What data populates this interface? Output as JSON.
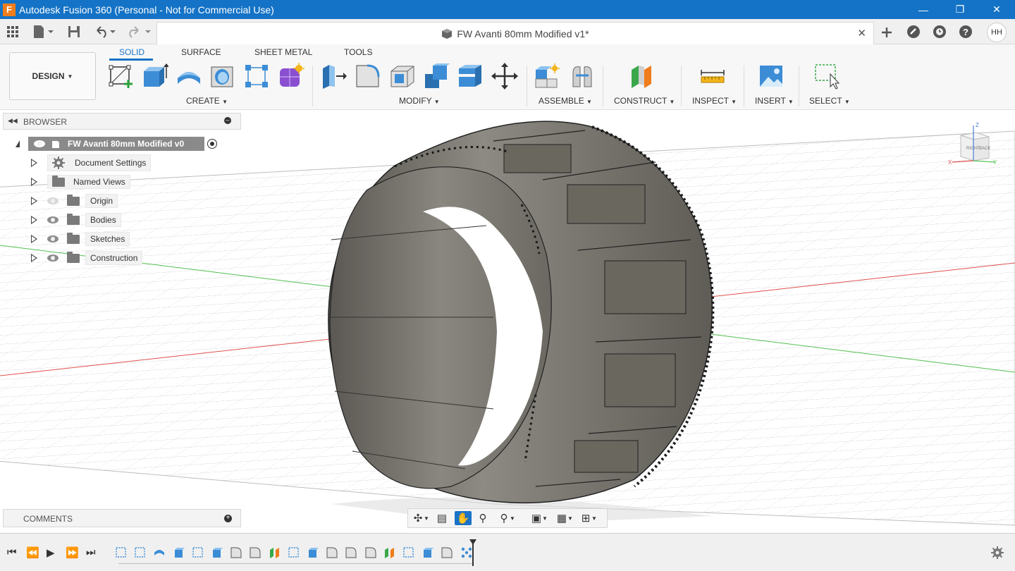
{
  "window": {
    "title": "Autodesk Fusion 360 (Personal - Not for Commercial Use)",
    "app_icon": "F"
  },
  "document": {
    "tab_title": "FW Avanti 80mm Modified v1*",
    "user_initials": "HH"
  },
  "workspace": {
    "label": "DESIGN"
  },
  "ribbon": {
    "tabs": [
      {
        "label": "SOLID",
        "active": true
      },
      {
        "label": "SURFACE"
      },
      {
        "label": "SHEET METAL"
      },
      {
        "label": "TOOLS"
      }
    ],
    "groups": {
      "create": "CREATE",
      "modify": "MODIFY",
      "assemble": "ASSEMBLE",
      "construct": "CONSTRUCT",
      "inspect": "INSPECT",
      "insert": "INSERT",
      "select": "SELECT"
    }
  },
  "browser": {
    "title": "BROWSER",
    "root": "FW Avanti 80mm Modified v0",
    "items": [
      {
        "label": "Document Settings",
        "icon": "gear-icon"
      },
      {
        "label": "Named Views",
        "icon": "folder-icon"
      },
      {
        "label": "Origin",
        "icon": "folder-icon",
        "visible": false
      },
      {
        "label": "Bodies",
        "icon": "folder-icon",
        "visible": true
      },
      {
        "label": "Sketches",
        "icon": "folder-icon",
        "visible": true
      },
      {
        "label": "Construction",
        "icon": "folder-icon",
        "visible": true
      }
    ]
  },
  "comments": {
    "title": "COMMENTS"
  },
  "viewcube": {
    "faces": [
      "RIGHT",
      "BACK"
    ],
    "axes": [
      "X",
      "Y",
      "Z"
    ]
  },
  "colors": {
    "titlebar": "#1473c6",
    "accent": "#1a73c7",
    "x_axis": "#e05050",
    "y_axis": "#50c050",
    "z_axis": "#4a7ed8",
    "model": "#7a7770"
  }
}
